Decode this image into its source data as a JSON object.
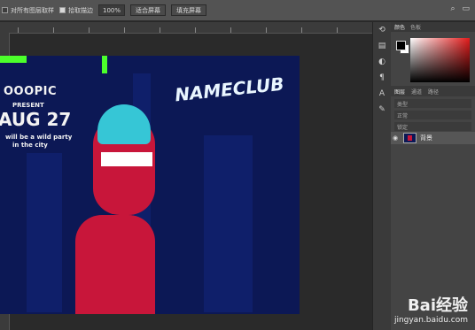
{
  "options_bar": {
    "checkbox1_label": "对所有图层取样",
    "checkbox2_label": "",
    "checkbox3_label": "拾取描边",
    "zoom_value": "100%",
    "button1_label": "适合屏幕",
    "button2_label": "填充屏幕"
  },
  "poster": {
    "brand": "OOOPIC",
    "present": "PRESENT",
    "date": "AUG 27",
    "tagline_1": "will be a wild party",
    "tagline_2": "in the city",
    "club": "NAMECLUB"
  },
  "color_panel": {
    "tabs": [
      "颜色",
      "色板"
    ],
    "fg": "#000000",
    "bg": "#ffffff",
    "hue": "#e21b1b"
  },
  "layers_panel": {
    "tabs": [
      "图层",
      "通道",
      "路径"
    ],
    "kind_filter": "类型",
    "blend_mode": "正常",
    "lock_label": "锁定",
    "layer_name": "背景"
  },
  "watermark": {
    "logo": "Bai经验",
    "url": "jingyan.baidu.com"
  }
}
